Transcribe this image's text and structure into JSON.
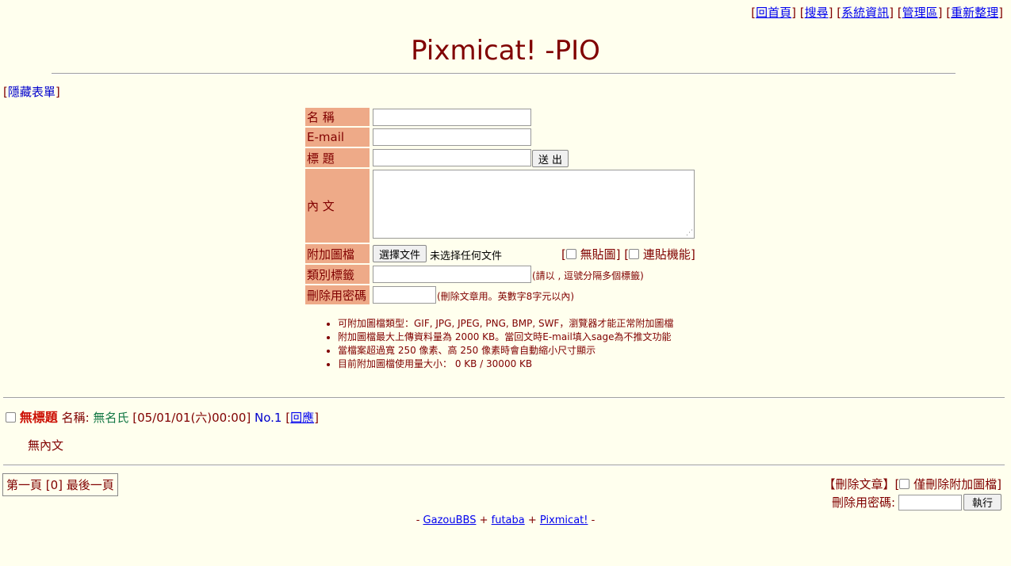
{
  "nav": {
    "home": "回首頁",
    "search": "搜尋",
    "sysinfo": "系統資訊",
    "admin": "管理區",
    "refresh": "重新整理"
  },
  "title": "Pixmicat! -PIO",
  "hide_form": "隱藏表單",
  "form": {
    "name_label": "名 稱",
    "email_label": "E-mail",
    "subject_label": "標 題",
    "submit_label": "送 出",
    "comment_label": "內 文",
    "file_label": "附加圖檔",
    "file_button": "選擇文件",
    "file_status": "未选择任何文件",
    "noimg_label": "無貼圖",
    "cont_label": "連貼機能",
    "category_label": "類別標籤",
    "category_note": "(請以 , 逗號分隔多個標籤)",
    "password_label": "刪除用密碼",
    "password_note": "(刪除文章用。英數字8字元以內)"
  },
  "rules": [
    "可附加圖檔類型：GIF, JPG, JPEG, PNG, BMP, SWF，瀏覽器才能正常附加圖檔",
    "附加圖檔最大上傳資料量為 2000 KB。當回文時E-mail填入sage為不推文功能",
    "當檔案超過寬 250 像素、高 250 像素時會自動縮小尺寸顯示",
    "目前附加圖檔使用量大小： 0 KB / 30000 KB"
  ],
  "post": {
    "title": "無標題",
    "name_prefix": "名稱:",
    "name": "無名氏",
    "date": "[05/01/01(六)00:00]",
    "no": "No.1",
    "reply": "回應",
    "body": "無內文"
  },
  "pager": {
    "text": "第一頁 [0] 最後一頁"
  },
  "delete": {
    "title": "【刪除文章】",
    "only_img_label": "僅刪除附加圖檔",
    "pwd_label": "刪除用密碼:",
    "exec": "執行"
  },
  "footer": {
    "gazou": "GazouBBS",
    "futaba": "futaba",
    "pixmicat": "Pixmicat!"
  }
}
